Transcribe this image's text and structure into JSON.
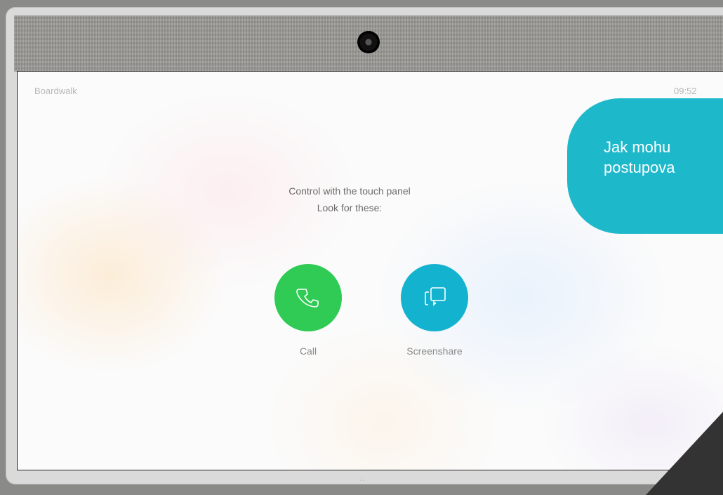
{
  "device": {
    "room_name": "Boardwalk",
    "clock": "09:52",
    "bottom_logo": "∴"
  },
  "main": {
    "instruction_line1": "Control with the touch panel",
    "instruction_line2": "Look for these:",
    "actions": [
      {
        "label": "Call",
        "icon": "phone-icon",
        "color": "#2fcb55"
      },
      {
        "label": "Screenshare",
        "icon": "screenshare-icon",
        "color": "#13b3cf"
      }
    ]
  },
  "overlay": {
    "bubble_line1": "Jak mohu",
    "bubble_line2": "postupova",
    "bubble_color": "#1eb8cb"
  }
}
